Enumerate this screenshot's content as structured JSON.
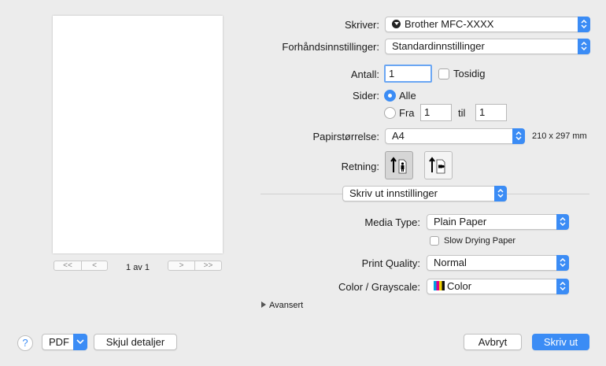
{
  "preview": {
    "page_counter": "1 av 1",
    "nav_first": "<<",
    "nav_prev": "<",
    "nav_next": ">",
    "nav_last": ">>"
  },
  "printer": {
    "label": "Skriver:",
    "value": "Brother MFC-XXXX"
  },
  "presets": {
    "label": "Forhåndsinnstillinger:",
    "value": "Standardinnstillinger"
  },
  "copies": {
    "label": "Antall:",
    "value": "1",
    "duplex_label": "Tosidig",
    "duplex_checked": false
  },
  "pages": {
    "label": "Sider:",
    "all_label": "Alle",
    "from_label": "Fra",
    "from_value": "1",
    "to_label": "til",
    "to_value": "1",
    "selected": "Alle"
  },
  "paper_size": {
    "label": "Papirstørrelse:",
    "value": "A4",
    "dimensions": "210 x 297 mm"
  },
  "orientation": {
    "label": "Retning:",
    "selected": "portrait"
  },
  "section": {
    "value": "Skriv ut innstillinger"
  },
  "media_type": {
    "label": "Media Type:",
    "value": "Plain Paper"
  },
  "slow_drying": {
    "label": "Slow Drying Paper",
    "checked": false
  },
  "print_quality": {
    "label": "Print Quality:",
    "value": "Normal"
  },
  "color_mode": {
    "label": "Color / Grayscale:",
    "value": "Color"
  },
  "advanced": {
    "label": "Avansert"
  },
  "footer": {
    "help": "?",
    "pdf": "PDF",
    "hide_details": "Skjul detaljer",
    "cancel": "Avbryt",
    "print": "Skriv ut"
  },
  "colors": {
    "accent": "#3b8cf5",
    "background": "#ececec"
  }
}
